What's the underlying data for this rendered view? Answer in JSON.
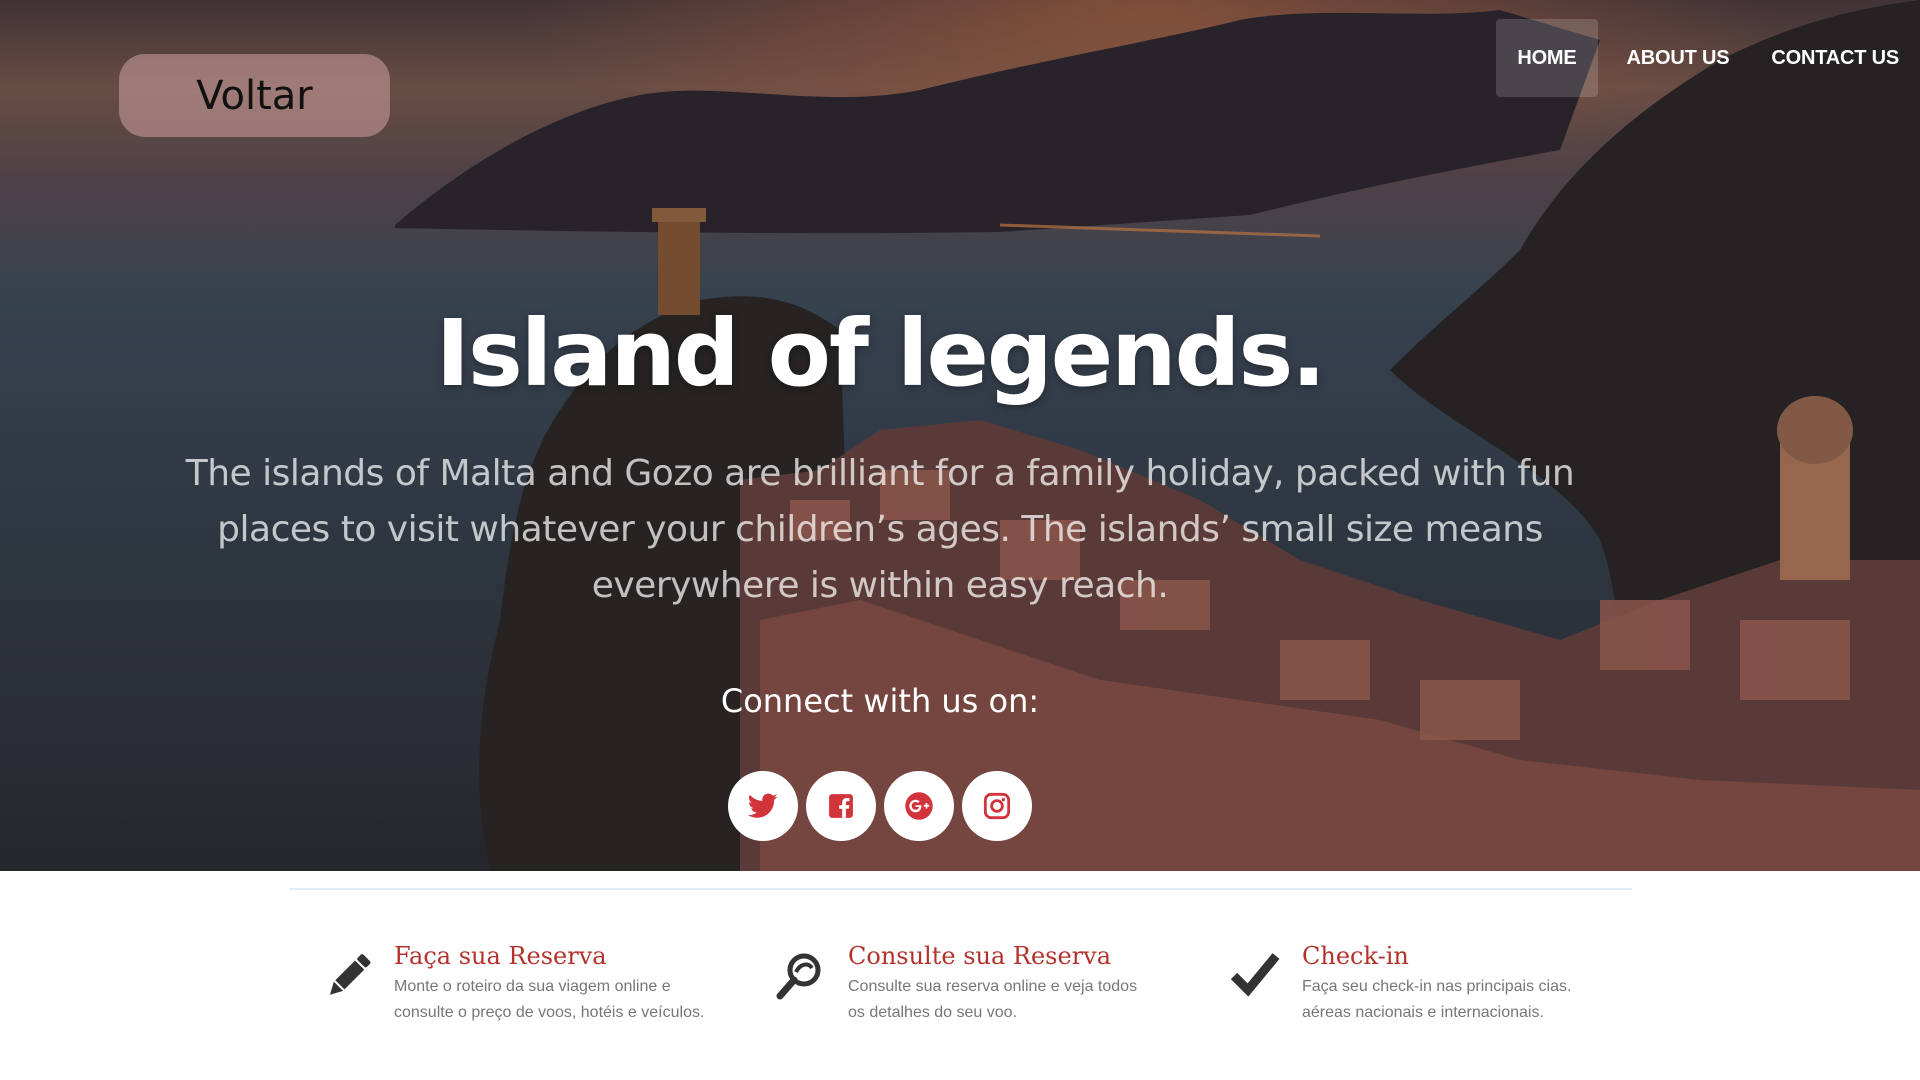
{
  "back_button": {
    "label": "Voltar"
  },
  "nav": {
    "items": [
      {
        "label": "HOME",
        "active": true
      },
      {
        "label": "ABOUT US",
        "active": false
      },
      {
        "label": "CONTACT US",
        "active": false
      }
    ]
  },
  "hero": {
    "title": "Island of legends.",
    "description": "The islands of Malta and Gozo are brilliant for a family holiday, packed with fun places to visit whatever your children’s ages. The islands’ small size means everywhere is within easy reach.",
    "connect_label": "Connect with us on:",
    "socials": [
      {
        "icon": "twitter-icon"
      },
      {
        "icon": "facebook-icon"
      },
      {
        "icon": "google-plus-icon"
      },
      {
        "icon": "instagram-icon"
      }
    ]
  },
  "features": [
    {
      "icon": "pencil-icon",
      "title": "Faça sua Reserva",
      "description_line1": "Monte o roteiro da sua viagem online e",
      "description_line2": "consulte o preço de voos, hotéis e veículos."
    },
    {
      "icon": "search-reservation-icon",
      "title": "Consulte sua Reserva",
      "description_line1": "Consulte sua reserva online e veja todos",
      "description_line2": "os detalhes do seu voo."
    },
    {
      "icon": "checkmark-icon",
      "title": "Check-in",
      "description_line1": "Faça seu check-in nas principais cias.",
      "description_line2": "aéreas nacionais e internacionais."
    }
  ],
  "colors": {
    "feature_title": "#b4322c",
    "social_icon": "#d2343c",
    "feature_icon": "#333333"
  }
}
